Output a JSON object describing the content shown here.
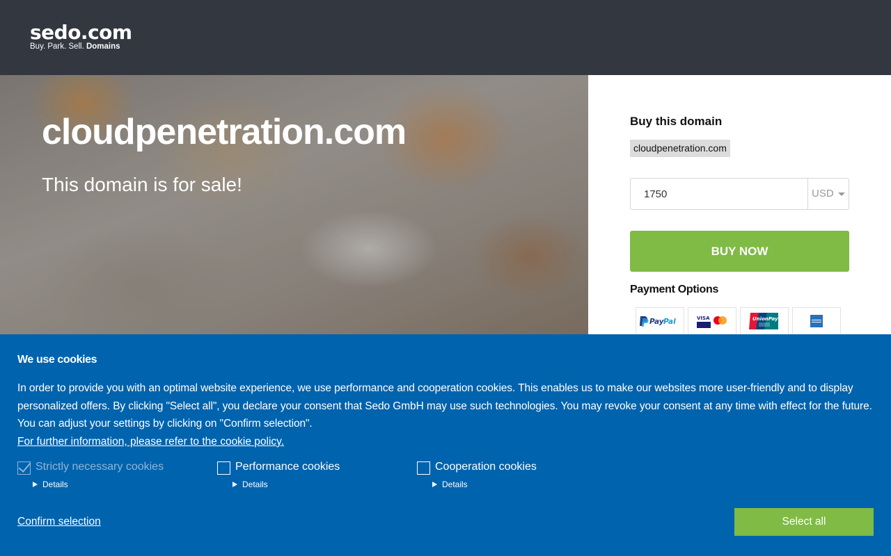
{
  "header": {
    "logo_main": "sedo.com",
    "logo_tag_plain": "Buy.  Park.  Sell.",
    "logo_tag_bold": "Domains"
  },
  "hero": {
    "domain": "cloudpenetration.com",
    "subtitle": "This domain is for sale!"
  },
  "buy_panel": {
    "title": "Buy this domain",
    "domain_chip": "cloudpenetration.com",
    "price_value": "1750",
    "currency": "USD",
    "buy_button": "BUY NOW",
    "payment_title": "Payment Options",
    "payment_icons": [
      "paypal-icon",
      "visa-mastercard-icon",
      "unionpay-icon",
      "amex-icon"
    ]
  },
  "cookie_banner": {
    "title": "We use cookies",
    "text": "In order to provide you with an optimal website experience, we use performance and cooperation cookies. This enables us to make our websites more user-friendly and to display personalized offers. By clicking \"Select all\", you declare your consent that Sedo GmbH may use such technologies. You may revoke your consent at any time with effect for the future. You can adjust your settings by clicking on \"Confirm selection\".",
    "policy_link": "For further information, please refer to the cookie policy.",
    "options": [
      {
        "label": "Strictly necessary cookies",
        "details": "Details",
        "checked": true
      },
      {
        "label": "Performance cookies",
        "details": "Details",
        "checked": false
      },
      {
        "label": "Cooperation cookies",
        "details": "Details",
        "checked": false
      }
    ],
    "confirm_label": "Confirm selection",
    "select_all_label": "Select all"
  },
  "colors": {
    "header_bg": "#323740",
    "accent_green": "#7fbb45",
    "cookie_bg": "#0063ae"
  }
}
